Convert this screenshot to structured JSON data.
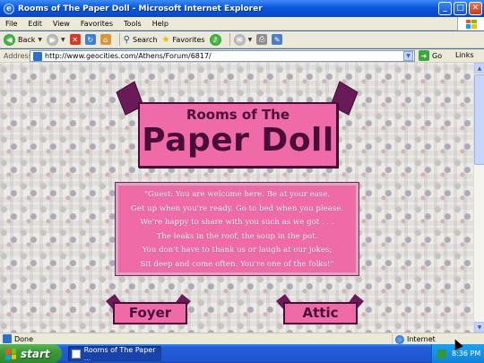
{
  "window": {
    "title": "Rooms of The Paper Doll - Microsoft Internet Explorer"
  },
  "menu": [
    "File",
    "Edit",
    "View",
    "Favorites",
    "Tools",
    "Help"
  ],
  "toolbar": {
    "back_label": "Back",
    "search_label": "Search",
    "favorites_label": "Favorites"
  },
  "address": {
    "label": "Address",
    "url": "http://www.geocities.com/Athens/Forum/6817/",
    "go_label": "Go",
    "links_label": "Links"
  },
  "page": {
    "heading_small": "Rooms of The",
    "heading_large": "Paper Doll",
    "poem_lines": [
      "\"Guest: You are welcome here. Be at your ease.",
      "Get up when you're ready. Go to bed when you please.",
      "We're happy to share with you such as we got . . .",
      "The leaks in the roof, the soup in the pot.",
      "You don't have to thank us or laugh at our jokes;",
      "Sit deep and come often. You're one of the folks!\""
    ],
    "foyer_label": "Foyer",
    "attic_label": "Attic"
  },
  "status": {
    "text": "Done",
    "zone": "Internet"
  },
  "taskbar": {
    "start_label": "start",
    "task_label": "Rooms of The Paper ...",
    "clock": "8:36 PM"
  },
  "colors": {
    "sign_pink": "#ef6ba8",
    "sign_border": "#4a0d3a",
    "xp_blue": "#245edb"
  }
}
